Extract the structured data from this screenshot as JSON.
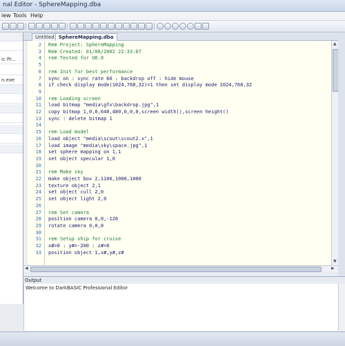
{
  "window": {
    "title": "nal Editor - SphereMapping.dba"
  },
  "menu": {
    "items": [
      "iew",
      "Tools",
      "Help"
    ]
  },
  "left_panel": {
    "items": [
      "ic Pr...",
      "n.exe"
    ]
  },
  "tabs": [
    {
      "label": "Untitled1",
      "active": false
    },
    {
      "label": "SphereMapping.dba",
      "active": true
    }
  ],
  "code_lines": [
    {
      "n": "2",
      "text": "Rem Project: SphereMapping",
      "kind": "comment"
    },
    {
      "n": "3",
      "text": "Rem Created: 01/08/2002 22:33:07",
      "kind": "comment"
    },
    {
      "n": "4",
      "text": "rem Tested for U6.0",
      "kind": "comment"
    },
    {
      "n": "5",
      "text": "",
      "kind": "normal"
    },
    {
      "n": "6",
      "text": "rem Init for best performance",
      "kind": "comment"
    },
    {
      "n": "7",
      "text": "sync on : sync rate 60 : backdrop off : hide mouse",
      "kind": "normal"
    },
    {
      "n": "8",
      "text": "if check display mode(1024,768,32)=1 then set display mode 1024,768,32",
      "kind": "normal"
    },
    {
      "n": "9",
      "text": "",
      "kind": "normal"
    },
    {
      "n": "10",
      "text": "rem Loading screen",
      "kind": "comment"
    },
    {
      "n": "11",
      "text": "load bitmap \"media\\gfx\\backdrop.jpg\",1",
      "kind": "normal"
    },
    {
      "n": "12",
      "text": "copy bitmap 1,0,0,640,480,0,0,0,screen width(),screen height()",
      "kind": "normal"
    },
    {
      "n": "13",
      "text": "sync : delete bitmap 1",
      "kind": "normal"
    },
    {
      "n": "14",
      "text": "",
      "kind": "normal"
    },
    {
      "n": "15",
      "text": "rem Load model",
      "kind": "comment"
    },
    {
      "n": "16",
      "text": "load object \"media\\scout\\scout2.x\",1",
      "kind": "normal"
    },
    {
      "n": "17",
      "text": "load image \"media\\sky\\space.jpg\",1",
      "kind": "normal"
    },
    {
      "n": "18",
      "text": "set sphere mapping on 1,1",
      "kind": "normal"
    },
    {
      "n": "19",
      "text": "set object specular 1,0",
      "kind": "normal"
    },
    {
      "n": "20",
      "text": "",
      "kind": "normal"
    },
    {
      "n": "21",
      "text": "rem Make sky",
      "kind": "comment"
    },
    {
      "n": "22",
      "text": "make object box 2,1100,1000,1000",
      "kind": "normal"
    },
    {
      "n": "23",
      "text": "texture object 2,1",
      "kind": "normal"
    },
    {
      "n": "24",
      "text": "set object cull 2,0",
      "kind": "normal"
    },
    {
      "n": "25",
      "text": "set object light 2,0",
      "kind": "normal"
    },
    {
      "n": "26",
      "text": "",
      "kind": "normal"
    },
    {
      "n": "27",
      "text": "rem Set camera",
      "kind": "comment"
    },
    {
      "n": "28",
      "text": "position camera 0,0,-120",
      "kind": "normal"
    },
    {
      "n": "29",
      "text": "rotate camera 0,0,0",
      "kind": "normal"
    },
    {
      "n": "30",
      "text": "",
      "kind": "normal"
    },
    {
      "n": "31",
      "text": "rem Setup ship for cruise",
      "kind": "comment"
    },
    {
      "n": "32",
      "text": "x#=0 : y#=-200 : z#=0",
      "kind": "normal"
    },
    {
      "n": "33",
      "text": "position object 1,x#,y#,z#",
      "kind": "normal"
    }
  ],
  "output": {
    "title": "Output",
    "lines": [
      "Welcome to DarkBASIC Professional Editor"
    ]
  }
}
